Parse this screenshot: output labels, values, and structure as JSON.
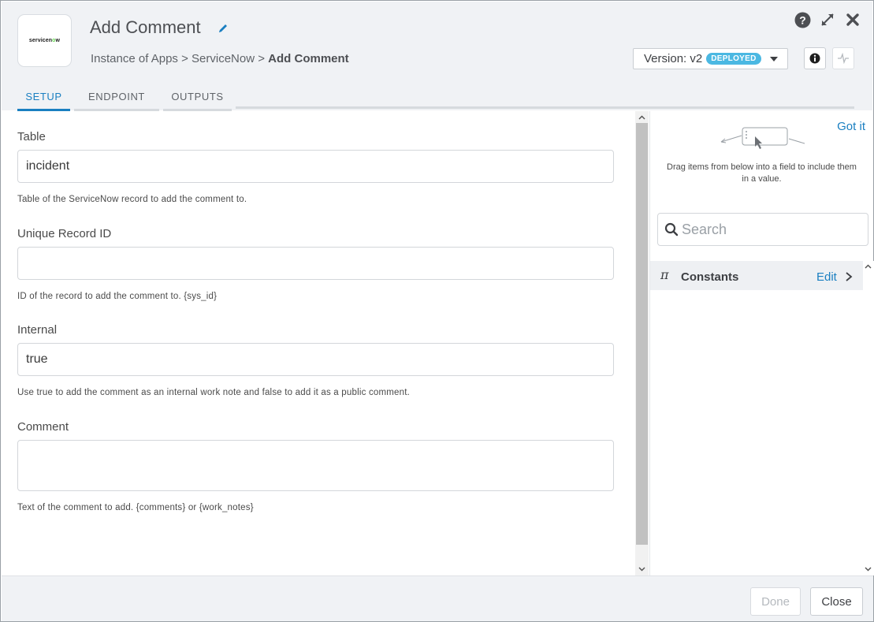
{
  "header": {
    "logo_text_pre": "servicen",
    "logo_text_o": "o",
    "logo_text_post": "w",
    "title": "Add Comment",
    "breadcrumb": {
      "part1": "Instance of Apps",
      "sep1": " > ",
      "part2": "ServiceNow",
      "sep2": " > ",
      "current": "Add Comment"
    },
    "version_label": "Version: v2",
    "version_badge": "DEPLOYED",
    "icons": [
      "help-icon",
      "expand-icon",
      "close-icon",
      "info-icon",
      "activity-icon",
      "pencil-icon"
    ]
  },
  "tabs": [
    {
      "label": "SETUP",
      "active": true
    },
    {
      "label": "ENDPOINT",
      "active": false
    },
    {
      "label": "OUTPUTS",
      "active": false
    }
  ],
  "form": {
    "table": {
      "label": "Table",
      "value": "incident",
      "help": "Table of the ServiceNow record to add the comment to."
    },
    "record_id": {
      "label": "Unique Record ID",
      "value": "",
      "help": "ID of the record to add the comment to. {sys_id}"
    },
    "internal": {
      "label": "Internal",
      "value": "true",
      "help": "Use true to add the comment as an internal work note and false to add it as a public comment."
    },
    "comment": {
      "label": "Comment",
      "value": "",
      "help": "Text of the comment to add. {comments} or {work_notes}"
    }
  },
  "side": {
    "got_it": "Got it",
    "drag_hint": "Drag items from below into a field to include them in a value.",
    "search_placeholder": "Search",
    "constants_label": "Constants",
    "edit_label": "Edit"
  },
  "footer": {
    "done_label": "Done",
    "close_label": "Close"
  },
  "colors": {
    "accent": "#1a7fc1",
    "badge": "#4bb8e2",
    "header_bg": "#f0f2f5"
  }
}
